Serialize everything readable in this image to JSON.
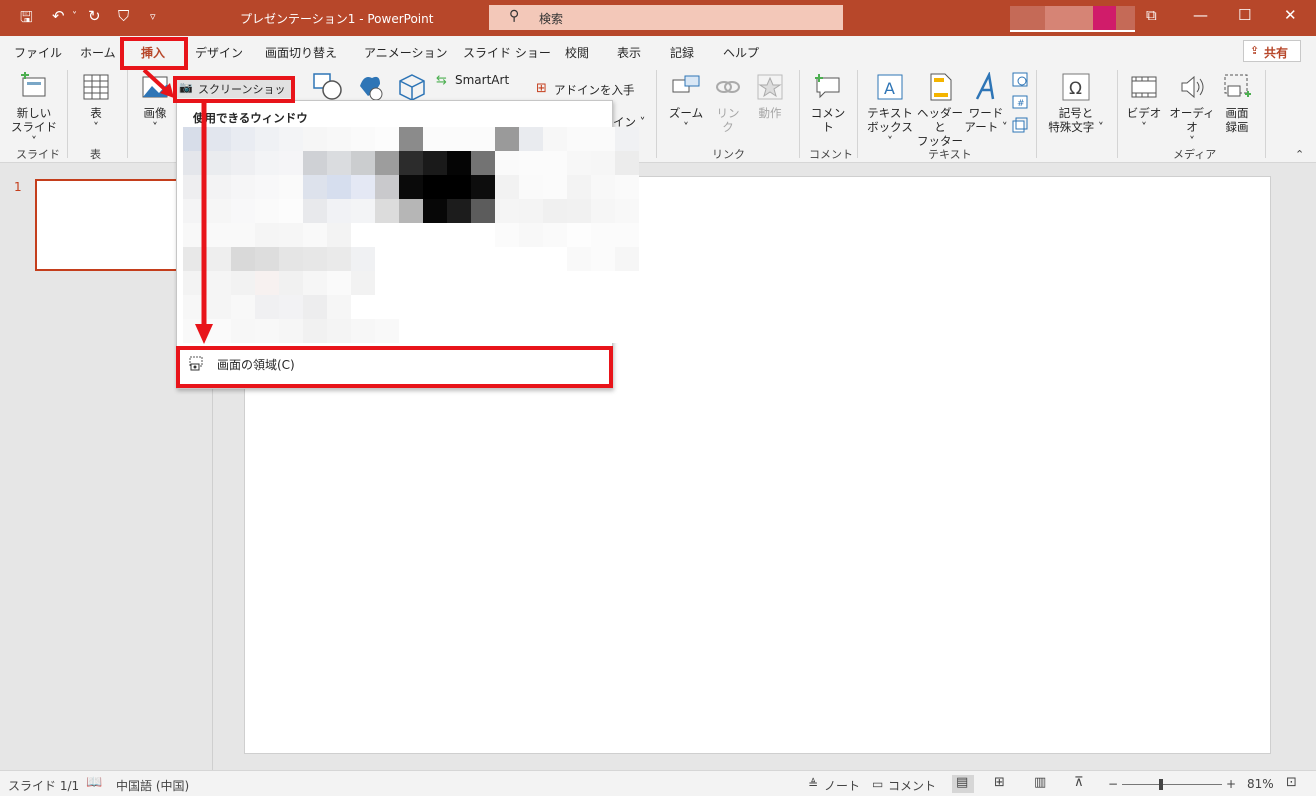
{
  "window": {
    "title": "プレゼンテーション1  -  PowerPoint",
    "search_placeholder": "検索",
    "controls": {
      "ribbon_display": "⧉",
      "minimize": "—",
      "maximize": "☐",
      "close": "✕"
    }
  },
  "quick_access": {
    "save": "🖫",
    "undo": "↶",
    "undo_dropdown": "˅",
    "redo": "↻",
    "present": "⛉",
    "customize": "▿"
  },
  "tabs": [
    "ファイル",
    "ホーム",
    "挿入",
    "デザイン",
    "画面切り替え",
    "アニメーション",
    "スライド ショー",
    "校閲",
    "表示",
    "記録",
    "ヘルプ"
  ],
  "active_tab": "挿入",
  "share_label": "共有",
  "ribbon": {
    "new_slide": {
      "line1": "新しい",
      "line2": "スライド ˅"
    },
    "table": {
      "line1": "表",
      "line2": "˅"
    },
    "image": {
      "line1": "画像",
      "line2": "˅"
    },
    "screenshot": "スクリーンショット ˅",
    "smartart": "SmartArt",
    "get_addins": "アドインを入手",
    "my_addins_partial": "イン ˅",
    "zoom": {
      "line1": "ズーム",
      "line2": "˅"
    },
    "link": {
      "line1": "リン",
      "line2": "ク"
    },
    "action": "動作",
    "comment": "コメント",
    "textbox": {
      "line1": "テキスト",
      "line2": "ボックス ˅"
    },
    "header_footer": {
      "line1": "ヘッダーと",
      "line2": "フッター"
    },
    "wordart": {
      "line1": "ワード",
      "line2": "アート ˅"
    },
    "symbols": {
      "line1": "記号と",
      "line2": "特殊文字 ˅"
    },
    "video": {
      "line1": "ビデオ",
      "line2": "˅"
    },
    "audio": {
      "line1": "オーディオ",
      "line2": "˅"
    },
    "screen_recording": {
      "line1": "画面",
      "line2": "録画"
    },
    "groups": {
      "slides": "スライド",
      "table": "表",
      "links": "リンク",
      "comments": "コメント",
      "text": "テキスト",
      "media": "メディア"
    }
  },
  "dropdown": {
    "heading": "使用できるウィンドウ",
    "screen_clipping": "画面の領域(C)"
  },
  "slide_pane": {
    "slide_number": "1"
  },
  "status": {
    "slide_counter": "スライド 1/1",
    "language": "中国語 (中国)",
    "notes": "ノート",
    "comments": "コメント",
    "zoom_out": "−",
    "zoom_in": "+",
    "zoom_level": "81%",
    "zoom_fraction": 0.81
  },
  "colors": {
    "accent": "#b7472a",
    "annotation_red": "#e8141a",
    "slide_selected_border": "#c43e1c"
  }
}
